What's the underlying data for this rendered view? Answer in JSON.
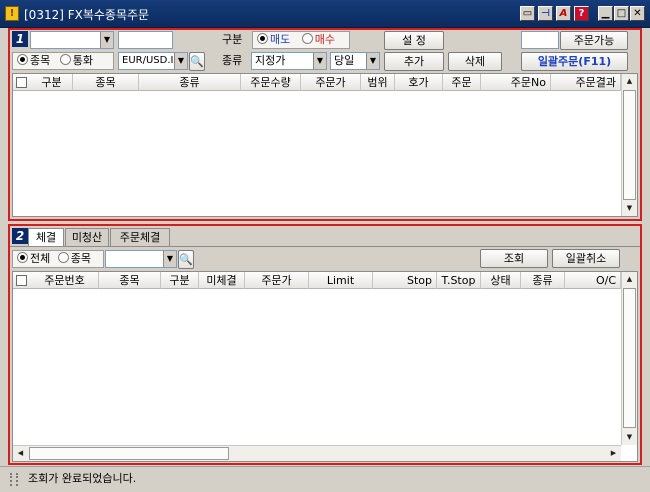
{
  "window": {
    "title": "[0312] FX복수종목주문",
    "app_icon_glyph": "!"
  },
  "top_panel": {
    "badge": "1",
    "gubun_label": "구분",
    "sell_label": "매도",
    "buy_label": "매수",
    "kind_label": "종류",
    "symbol_radio": "종목",
    "currency_radio": "통화",
    "symbol_value": "EUR/USD.I",
    "order_type": "지정가",
    "validity": "당일",
    "settings_button": "설 정",
    "add_button": "추가",
    "delete_button": "삭제",
    "orderable_button": "주문가능",
    "bulk_order_button": "일괄주문(F11)",
    "columns": [
      "구분",
      "종목",
      "종류",
      "주문수량",
      "주문가",
      "범위",
      "호가",
      "주문",
      "주문No",
      "주문결과"
    ]
  },
  "bottom_panel": {
    "badge": "2",
    "tabs": [
      "체결",
      "미청산",
      "주문체결"
    ],
    "all_radio": "전체",
    "symbol_radio": "종목",
    "query_button": "조회",
    "cancel_all_button": "일괄취소",
    "columns": [
      "주문번호",
      "종목",
      "구분",
      "미체결",
      "주문가",
      "Limit",
      "Stop",
      "T.Stop",
      "상태",
      "종류",
      "O/C"
    ]
  },
  "status": {
    "message": "조회가 완료되었습니다."
  }
}
